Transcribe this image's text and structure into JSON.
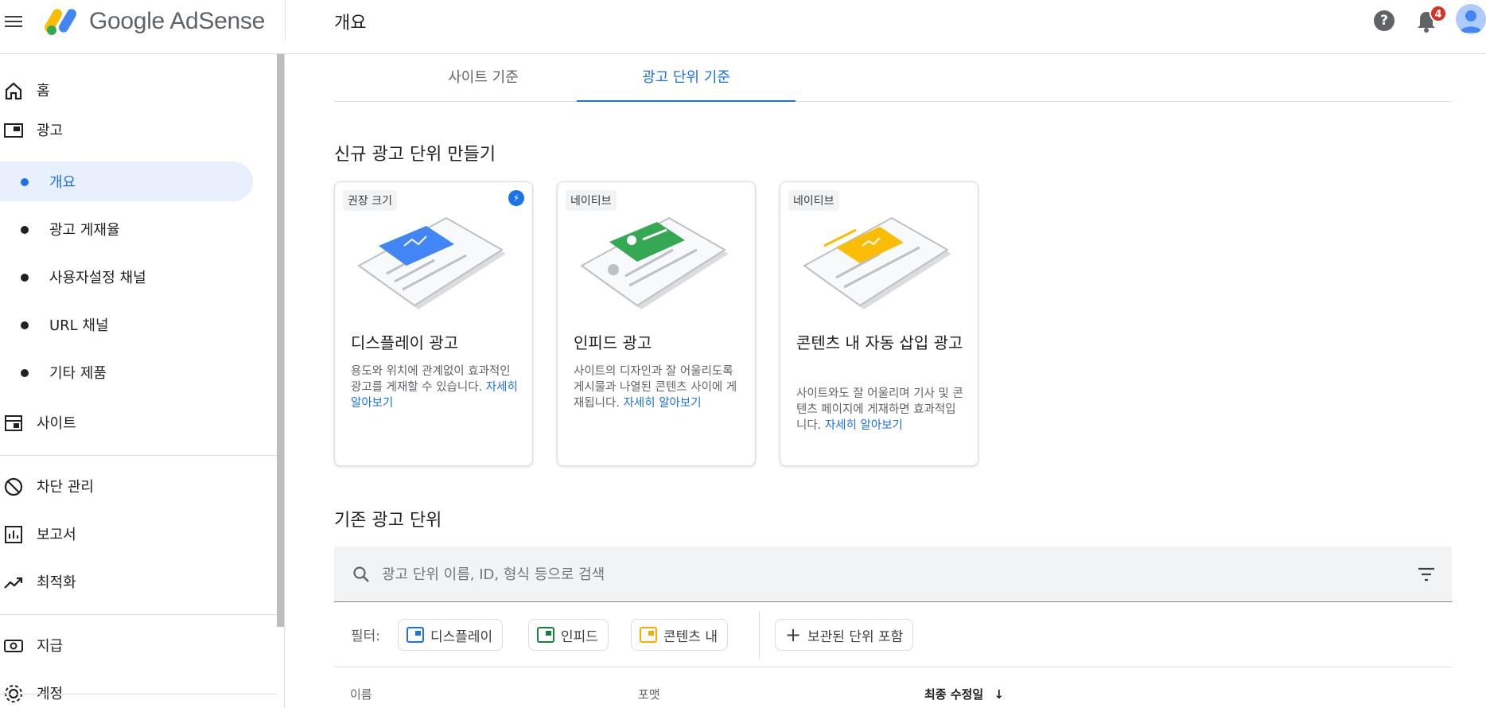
{
  "header": {
    "brand": "Google AdSense",
    "page_title": "개요",
    "notification_count": "4",
    "help_glyph": "?"
  },
  "sidebar": {
    "items": [
      {
        "label": "홈",
        "icon": "home-icon"
      },
      {
        "label": "광고",
        "icon": "ads-icon"
      },
      {
        "label": "개요",
        "sub": true,
        "active": true
      },
      {
        "label": "광고 게재율",
        "sub": true
      },
      {
        "label": "사용자설정 채널",
        "sub": true
      },
      {
        "label": "URL 채널",
        "sub": true
      },
      {
        "label": "기타 제품",
        "sub": true
      },
      {
        "label": "사이트",
        "icon": "site-icon"
      },
      {
        "label": "차단 관리",
        "icon": "block-icon"
      },
      {
        "label": "보고서",
        "icon": "report-icon"
      },
      {
        "label": "최적화",
        "icon": "trending-up-icon"
      },
      {
        "label": "지급",
        "icon": "payments-icon"
      },
      {
        "label": "계정",
        "icon": "settings-icon"
      }
    ]
  },
  "tabs": [
    {
      "label": "사이트 기준",
      "active": false
    },
    {
      "label": "광고 단위 기준",
      "active": true
    }
  ],
  "create_section": {
    "title": "신규 광고 단위 만들기",
    "cards": [
      {
        "chip": "권장 크기",
        "title": "디스플레이 광고",
        "desc": "용도와 위치에 관계없이 효과적인 광고를 게재할 수 있습니다. ",
        "link": "자세히 알아보기",
        "color": "#4285f4"
      },
      {
        "chip": "네이티브",
        "title": "인피드 광고",
        "desc": "사이트의 디자인과 잘 어울리도록 게시물과 나열된 콘텐츠 사이에 게재됩니다. ",
        "link": "자세히 알아보기",
        "color": "#34a853"
      },
      {
        "chip": "네이티브",
        "title": "콘텐츠 내 자동 삽입 광고",
        "desc": "사이트와도 잘 어울리며 기사 및 콘텐츠 페이지에 게재하면 효과적입니다. ",
        "link": "자세히 알아보기",
        "color": "#fbbc04"
      }
    ]
  },
  "existing_section": {
    "title": "기존 광고 단위",
    "search_placeholder": "광고 단위 이름, ID, 형식 등으로 검색",
    "filter_label": "필터:",
    "filters": [
      {
        "label": "디스플레이",
        "color": "#1a73e8"
      },
      {
        "label": "인피드",
        "color": "#188038"
      },
      {
        "label": "콘텐츠 내",
        "color": "#f9ab00"
      }
    ],
    "archived_label": "보관된 단위 포함",
    "columns": {
      "name": "이름",
      "format": "포맷",
      "modified": "최종 수정일"
    }
  }
}
